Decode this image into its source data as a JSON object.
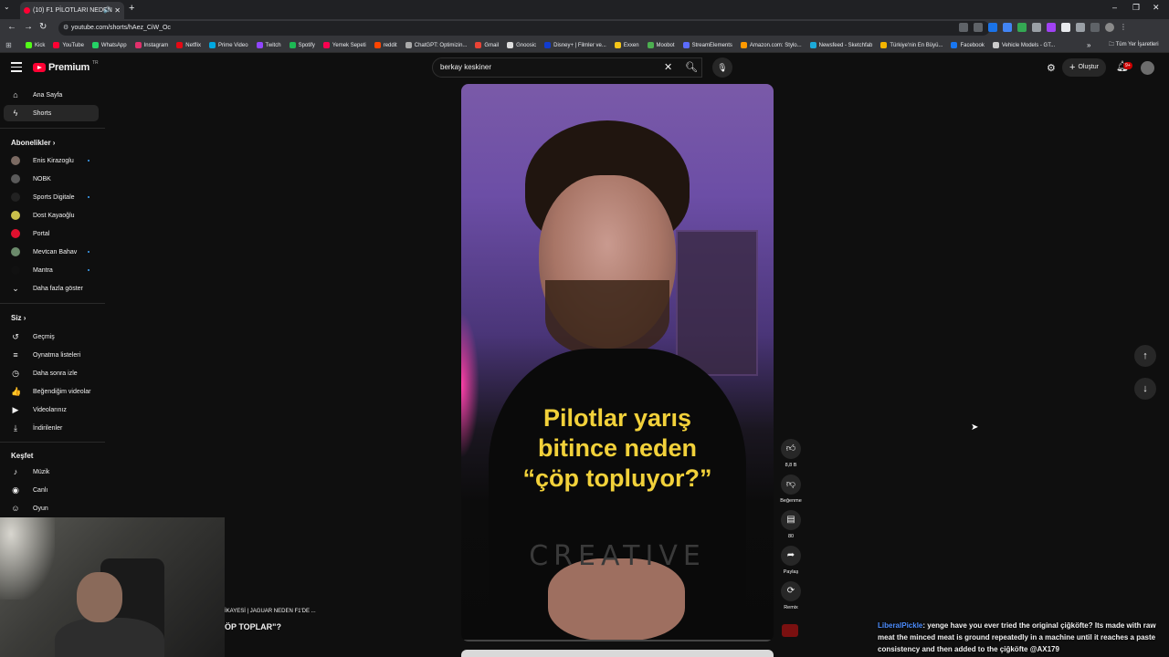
{
  "browser": {
    "tab_title": "(10) F1 PİLOTLARI NEDEN ",
    "url": "youtube.com/shorts/hAez_CiW_Oc",
    "bookmarks": [
      {
        "label": "Kick",
        "color": "#53fc18"
      },
      {
        "label": "YouTube",
        "color": "#ff0033"
      },
      {
        "label": "WhatsApp",
        "color": "#25d366"
      },
      {
        "label": "Instagram",
        "color": "#e1306c"
      },
      {
        "label": "Netflix",
        "color": "#e50914"
      },
      {
        "label": "Prime Video",
        "color": "#00a8e1"
      },
      {
        "label": "Twitch",
        "color": "#9146ff"
      },
      {
        "label": "Spotify",
        "color": "#1db954"
      },
      {
        "label": "Yemek Sepeti",
        "color": "#fa0050"
      },
      {
        "label": "reddit",
        "color": "#ff4500"
      },
      {
        "label": "ChatGPT: Optimizin...",
        "color": "#aaaaaa"
      },
      {
        "label": "Gmail",
        "color": "#ea4335"
      },
      {
        "label": "Gnoosic",
        "color": "#dddddd"
      },
      {
        "label": "Disney+ | Filmler ve...",
        "color": "#113ccf"
      },
      {
        "label": "Exxen",
        "color": "#f5c518"
      },
      {
        "label": "Moobot",
        "color": "#4caf50"
      },
      {
        "label": "StreamElements",
        "color": "#5b6cff"
      },
      {
        "label": "Amazon.com: Stylo...",
        "color": "#ff9900"
      },
      {
        "label": "Newsfeed - Sketchfab",
        "color": "#1caad9"
      },
      {
        "label": "Türkiye'nin En Büyü...",
        "color": "#f4b400"
      },
      {
        "label": "Facebook",
        "color": "#1877f2"
      },
      {
        "label": "Vehicle Models - GT...",
        "color": "#cccccc"
      }
    ],
    "all_bookmarks_label": "Tüm Yer İşaretleri",
    "more_label": "»"
  },
  "header": {
    "logo_word": "Premium",
    "logo_region": "TR",
    "search_value": "berkay keskiner",
    "create_label": "Oluştur",
    "notif_badge": "9+"
  },
  "sidebar": {
    "main": [
      {
        "label": "Ana Sayfa",
        "icon": "home-icon",
        "glyph": "⌂"
      },
      {
        "label": "Shorts",
        "icon": "shorts-icon",
        "glyph": "ϟ"
      }
    ],
    "subs_heading": "Abonelikler",
    "subs": [
      {
        "label": "Enis Kirazoglu",
        "color": "#7b6a62",
        "dot": true
      },
      {
        "label": "NOBK",
        "color": "#5a5a5a",
        "dot": false
      },
      {
        "label": "Sports Digitale",
        "color": "#222222",
        "dot": true
      },
      {
        "label": "Dost Kayaoğlu",
        "color": "#c9c04b",
        "dot": false
      },
      {
        "label": "Portal",
        "color": "#e0102e",
        "dot": false
      },
      {
        "label": "Mevtcan Bahav",
        "color": "#6b8a6b",
        "dot": true
      },
      {
        "label": "Mantra",
        "color": "#111111",
        "dot": true
      }
    ],
    "show_more": "Daha fazla göster",
    "you_heading": "Siz",
    "you": [
      {
        "label": "Geçmiş",
        "icon": "history-icon",
        "glyph": "↺"
      },
      {
        "label": "Oynatma listeleri",
        "icon": "playlists-icon",
        "glyph": "≡"
      },
      {
        "label": "Daha sonra izle",
        "icon": "watch-later-icon",
        "glyph": "◷"
      },
      {
        "label": "Beğendiğim videolar",
        "icon": "liked-videos-icon",
        "glyph": "👍"
      },
      {
        "label": "Videolarınız",
        "icon": "your-videos-icon",
        "glyph": "▶"
      },
      {
        "label": "İndirilenler",
        "icon": "downloads-icon",
        "glyph": "⤓"
      }
    ],
    "explore_heading": "Keşfet",
    "explore": [
      {
        "label": "Müzik",
        "icon": "music-icon",
        "glyph": "♪"
      },
      {
        "label": "Canlı",
        "icon": "live-icon",
        "glyph": "◉"
      },
      {
        "label": "Oyun",
        "icon": "gaming-icon",
        "glyph": "☺"
      }
    ]
  },
  "short": {
    "caption_line1": "Pilotlar yarış",
    "caption_line2": "bitince neden",
    "caption_line3": "“çöp topluyor?”",
    "shirt_text": "CREATIVE",
    "progress": 0.0,
    "like_count": "8,8 B",
    "dislike_label": "Beğenme",
    "comment_count": "80",
    "share_label": "Paylaş",
    "remix_label": "Remix"
  },
  "stream": {
    "title_line1": "İKAYESİ | JAGUAR NEDEN F1'DE ...",
    "title_line2": "ÖP TOPLAR\"?"
  },
  "chat": {
    "user": "LiberalPickle",
    "message": ": yenge have you ever tried the original çiğköfte? Its made with raw meat the minced meat is ground repeatedly in a machine until it reaches a paste consistency and then added to the çiğköfte @AX179"
  }
}
